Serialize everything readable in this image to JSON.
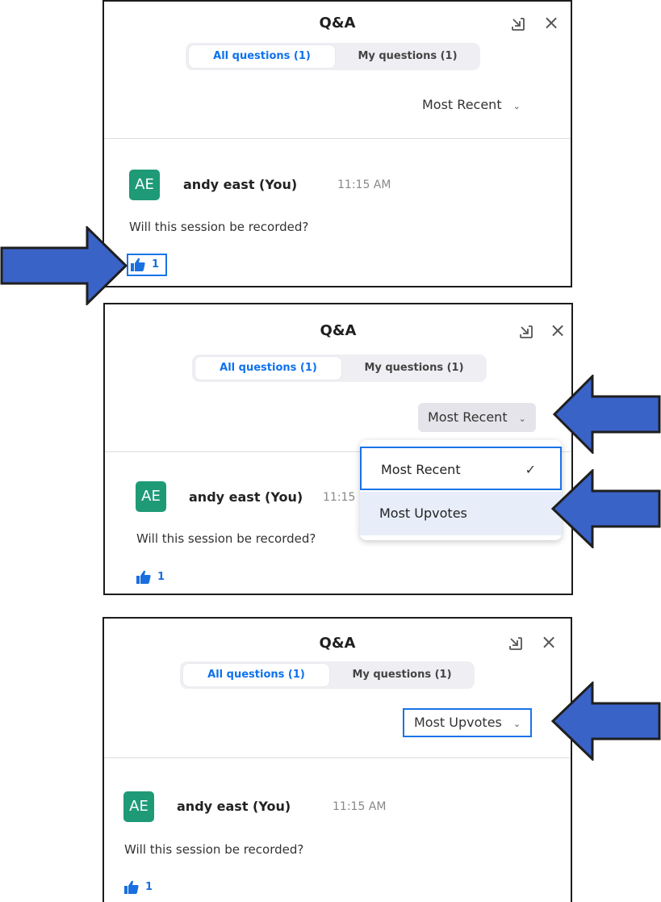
{
  "panels": [
    {
      "title": "Q&A",
      "tabs": {
        "all": "All questions (1)",
        "mine": "My questions (1)"
      },
      "sort_label": "Most Recent",
      "question": {
        "avatar": "AE",
        "user": "andy east (You)",
        "time": "11:15 AM",
        "text": "Will this session be recorded?",
        "upvotes": "1"
      }
    },
    {
      "title": "Q&A",
      "tabs": {
        "all": "All questions (1)",
        "mine": "My questions (1)"
      },
      "sort_label": "Most Recent",
      "dropdown": {
        "options": [
          "Most Recent",
          "Most Upvotes"
        ],
        "checkmark": "✓"
      },
      "question": {
        "avatar": "AE",
        "user": "andy east (You)",
        "time": "11:15",
        "text": "Will this session be recorded?",
        "upvotes": "1"
      }
    },
    {
      "title": "Q&A",
      "tabs": {
        "all": "All questions (1)",
        "mine": "My questions (1)"
      },
      "sort_label": "Most Upvotes",
      "question": {
        "avatar": "AE",
        "user": "andy east (You)",
        "time": "11:15 AM",
        "text": "Will this session be recorded?",
        "upvotes": "1"
      }
    }
  ],
  "icons": {
    "close": "close-icon",
    "pip": "pip-icon",
    "chevron": "chevron-down-icon",
    "thumbs_up": "thumbs-up-icon",
    "arrow": "arrow-annotation"
  },
  "colors": {
    "accent": "#0e72ed",
    "avatar": "#1e9a77",
    "arrow_fill": "#3a63c8",
    "highlight": "#1a73e8"
  }
}
